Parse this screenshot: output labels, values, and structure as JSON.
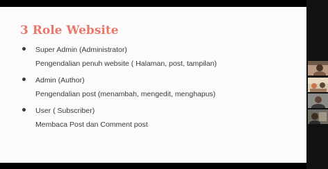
{
  "slide": {
    "title": "3 Role Website",
    "roles": [
      {
        "name": "Super Admin (Administrator)",
        "description": "Pengendalian penuh website ( Halaman, post, tampilan)"
      },
      {
        "name": "Admin (Author)",
        "description": "Pengendalian post (menambah, mengedit, menghapus)"
      },
      {
        "name": "User ( Subscriber)",
        "description": "Membaca Post dan Comment post"
      }
    ]
  },
  "colors": {
    "title": "#e8786a",
    "text": "#3a3a3a",
    "slide_background": "#fbfbfb",
    "frame_background": "#000000"
  },
  "participants": [
    {
      "icon": "participant-video-icon"
    },
    {
      "icon": "participant-video-icon"
    },
    {
      "icon": "participant-video-icon"
    },
    {
      "icon": "participant-video-icon"
    }
  ]
}
